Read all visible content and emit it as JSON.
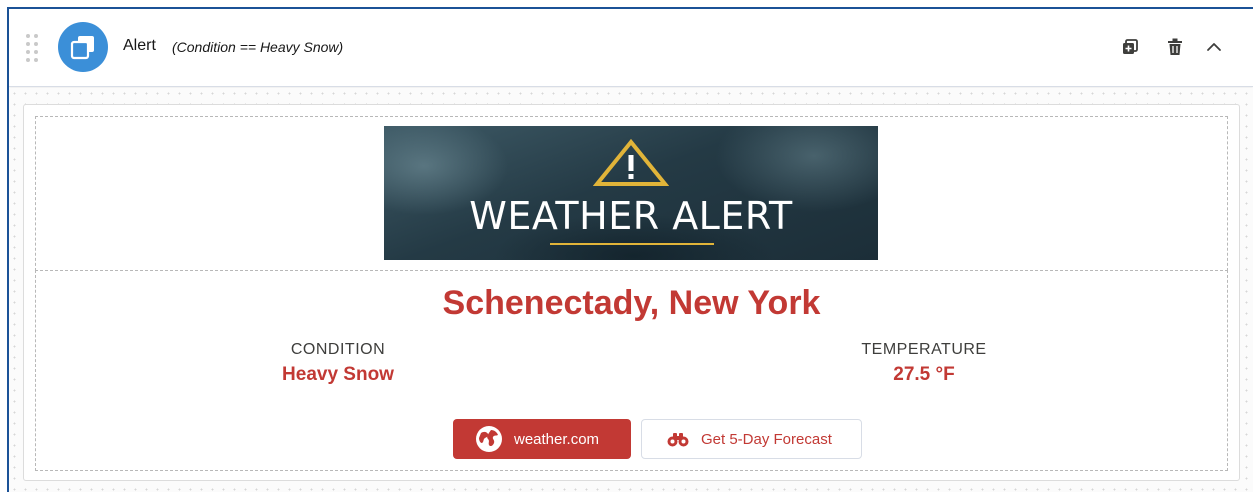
{
  "header": {
    "title": "Alert",
    "condition_expression": "(Condition == Heavy Snow)",
    "app_icon": "stacked-squares-icon",
    "actions": [
      "clone-icon",
      "delete-icon",
      "chevron-up-icon"
    ]
  },
  "banner": {
    "text": "WEATHER ALERT",
    "icon": "warning-triangle-icon"
  },
  "content": {
    "city": "Schenectady, New York",
    "condition_label": "CONDITION",
    "condition_value": "Heavy Snow",
    "temperature_label": "TEMPERATURE",
    "temperature_value": "27.5 °F"
  },
  "buttons": {
    "primary_label": "weather.com",
    "primary_icon": "globe-icon",
    "secondary_label": "Get 5-Day Forecast",
    "secondary_icon": "binoculars-icon"
  },
  "colors": {
    "accent": "#c23934",
    "icon_blue": "#3b8fd8",
    "focus_border": "#1b5297",
    "banner_gold": "#e1b439"
  }
}
